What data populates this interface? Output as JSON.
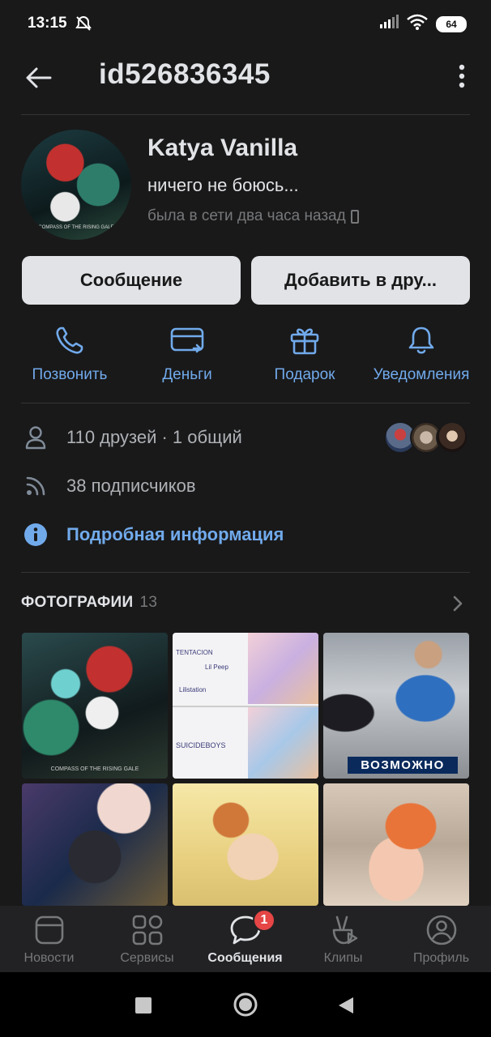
{
  "status_bar": {
    "time": "13:15",
    "battery": "64"
  },
  "header": {
    "title": "id526836345"
  },
  "profile": {
    "name": "Katya Vanilla",
    "status": "ничего не боюсь...",
    "online": "была в сети два часа назад",
    "avatar_caption": "COMPASS OF THE RISING GALE"
  },
  "buttons": {
    "message": "Сообщение",
    "add_friend": "Добавить в дру..."
  },
  "actions": [
    {
      "label": "Позвонить",
      "icon": "phone-icon"
    },
    {
      "label": "Деньги",
      "icon": "card-icon"
    },
    {
      "label": "Подарок",
      "icon": "gift-icon"
    },
    {
      "label": "Уведомления",
      "icon": "bell-icon"
    }
  ],
  "info": {
    "friends": "110 друзей · 1 общий",
    "followers": "38 подписчиков",
    "details": "Подробная информация"
  },
  "photos": {
    "title": "ФОТОГРАФИИ",
    "count": "13",
    "items": [
      {
        "caption": "COMPASS OF THE RISING GALE"
      },
      {
        "lines": [
          "TENTACION",
          "Lil Peep",
          "Lilistation",
          "SUICIDEBOYS"
        ]
      },
      {
        "overlay": "ВОЗМОЖНО"
      },
      {},
      {},
      {}
    ]
  },
  "tabbar": [
    {
      "label": "Новости",
      "icon": "news-icon",
      "active": false
    },
    {
      "label": "Сервисы",
      "icon": "services-icon",
      "active": false
    },
    {
      "label": "Сообщения",
      "icon": "messages-icon",
      "active": true,
      "badge": "1"
    },
    {
      "label": "Клипы",
      "icon": "clips-icon",
      "active": false
    },
    {
      "label": "Профиль",
      "icon": "profile-icon",
      "active": false
    }
  ],
  "colors": {
    "accent": "#71aaeb",
    "background": "#19191a",
    "badge": "#e64646"
  }
}
